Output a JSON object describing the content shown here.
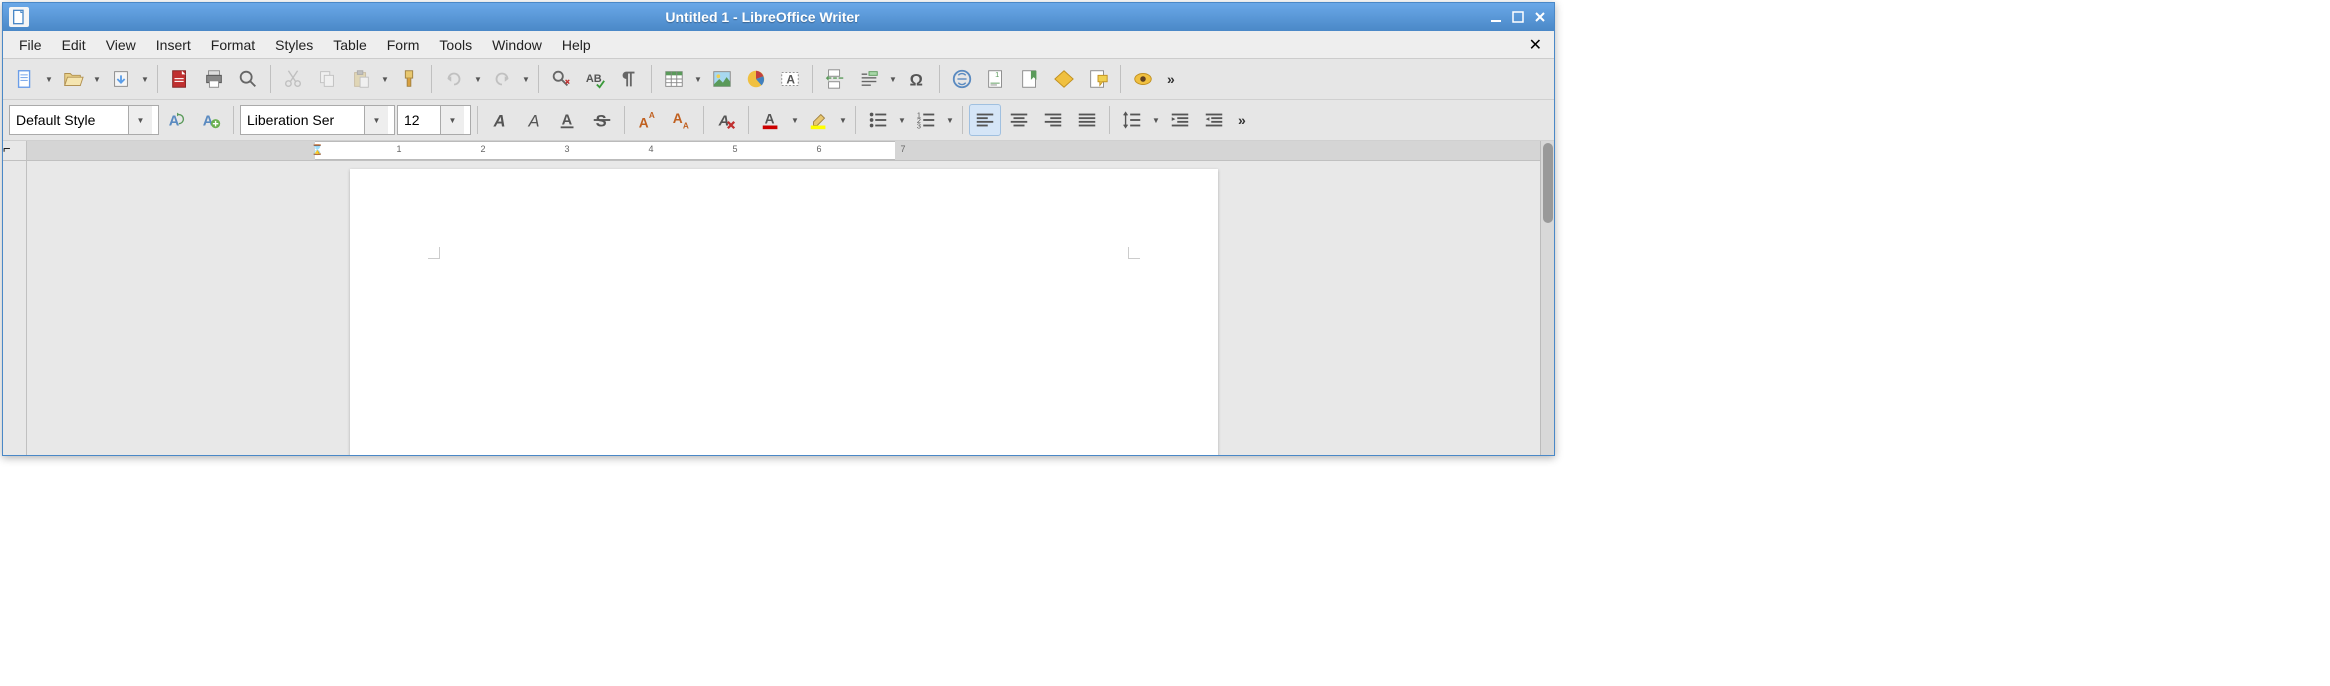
{
  "window": {
    "title": "Untitled 1 - LibreOffice Writer"
  },
  "menubar": {
    "items": [
      "File",
      "Edit",
      "View",
      "Insert",
      "Format",
      "Styles",
      "Table",
      "Form",
      "Tools",
      "Window",
      "Help"
    ]
  },
  "formatting": {
    "paragraph_style": "Default Style",
    "font_name": "Liberation Ser",
    "font_size": "12"
  },
  "ruler": {
    "numbers": [
      "1",
      "2",
      "3",
      "4",
      "5",
      "6",
      "7"
    ]
  },
  "colors": {
    "titlebar": "#4a88c7",
    "font_color": "#cc0000",
    "highlight_color": "#ffff00"
  }
}
